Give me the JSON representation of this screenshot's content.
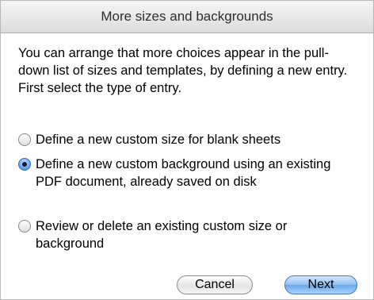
{
  "dialog": {
    "title": "More sizes and backgrounds",
    "intro": "You can arrange that more choices appear in the pull-down list of sizes and templates, by defining a new entry. First select the type of entry.",
    "options": [
      {
        "label": "Define a new custom size for blank sheets",
        "selected": false
      },
      {
        "label": "Define a new custom background using an existing PDF document, already saved on disk",
        "selected": true
      },
      {
        "label": "Review or delete an existing custom size or background",
        "selected": false
      }
    ],
    "buttons": {
      "cancel": "Cancel",
      "next": "Next"
    }
  }
}
